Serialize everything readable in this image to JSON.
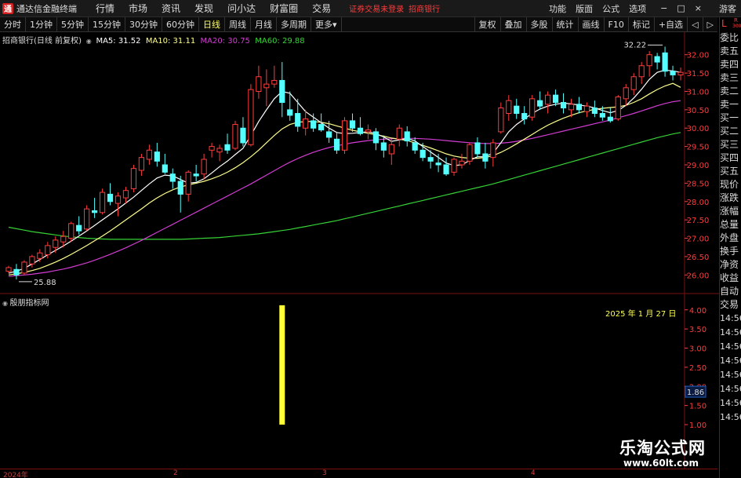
{
  "app": {
    "logo_glyph": "通",
    "title": "通达信金融终端"
  },
  "menu": [
    "行情",
    "市场",
    "资讯",
    "发现",
    "问小达",
    "财富圈",
    "交易"
  ],
  "login_warning": "证券交易未登录",
  "current_stock_tag": "招商银行",
  "right_menu": [
    "功能",
    "版面",
    "公式",
    "选项"
  ],
  "window_controls": [
    "−",
    "□",
    "×"
  ],
  "guest_label": "游客",
  "periods": [
    {
      "label": "分时",
      "active": false
    },
    {
      "label": "1分钟",
      "active": false
    },
    {
      "label": "5分钟",
      "active": false
    },
    {
      "label": "15分钟",
      "active": false
    },
    {
      "label": "30分钟",
      "active": false
    },
    {
      "label": "60分钟",
      "active": false
    },
    {
      "label": "日线",
      "active": true
    },
    {
      "label": "周线",
      "active": false
    },
    {
      "label": "月线",
      "active": false
    },
    {
      "label": "多周期",
      "active": false
    },
    {
      "label": "更多▾",
      "active": false
    }
  ],
  "toolbar_right": [
    "复权",
    "叠加",
    "多股",
    "统计",
    "画线",
    "F10",
    "标记",
    "+自选",
    "◁",
    "▷"
  ],
  "legend": {
    "stock": "招商银行(日线 前复权)",
    "ma5": "MA5: 31.52",
    "ma10": "MA10: 31.11",
    "ma20": "MA20: 30.75",
    "ma60": "MA60: 29.88"
  },
  "colors": {
    "up": "#ff3c3c",
    "down": "#54ffff",
    "ma5": "#ffffff",
    "ma10": "#ffff8c",
    "ma20": "#d23cd2",
    "ma60": "#36d236",
    "volume_bar": "#ffff33",
    "axis": "#ff3c3c"
  },
  "right_panel": {
    "lr_L": "L",
    "lr_R": "R",
    "lr_300": "300",
    "items": [
      "委比",
      "卖五",
      "卖四",
      "卖三",
      "卖二",
      "卖一",
      "买一",
      "买二",
      "买三",
      "买四",
      "买五",
      "现价",
      "涨跌",
      "涨幅",
      "总量",
      "外盘",
      "换手",
      "净资",
      "收益",
      "自动",
      "交易"
    ],
    "times": [
      "14:56",
      "14:56",
      "14:56",
      "14:56",
      "14:56",
      "14:56",
      "14:56",
      "14:56"
    ]
  },
  "indicator": {
    "title": "殷朋指标网",
    "date_label": "2025 年 1 月 27 日",
    "current_value": "1.86"
  },
  "date_axis": [
    "2024年",
    "2",
    "3",
    "4"
  ],
  "watermark": {
    "cn": "乐淘公式网",
    "url": "www.60lt.com"
  },
  "chart_data": [
    {
      "type": "candlestick",
      "title": "招商银行(日线 前复权)",
      "ylim": [
        25.6,
        32.4
      ],
      "y_ticks": [
        26.0,
        26.5,
        27.0,
        27.5,
        28.0,
        28.5,
        29.0,
        29.5,
        30.0,
        30.5,
        31.0,
        31.5,
        32.0
      ],
      "annotations": {
        "high": "32.22",
        "low": "25.88"
      },
      "candles": [
        [
          26.1,
          26.25,
          26.05,
          26.2
        ],
        [
          26.15,
          26.3,
          25.88,
          26.0
        ],
        [
          26.05,
          26.4,
          26.0,
          26.35
        ],
        [
          26.3,
          26.55,
          26.2,
          26.5
        ],
        [
          26.45,
          26.7,
          26.35,
          26.6
        ],
        [
          26.55,
          26.9,
          26.45,
          26.8
        ],
        [
          26.75,
          27.05,
          26.6,
          26.95
        ],
        [
          26.9,
          27.2,
          26.75,
          27.05
        ],
        [
          27.0,
          27.45,
          26.9,
          27.4
        ],
        [
          27.35,
          27.6,
          27.1,
          27.2
        ],
        [
          27.25,
          27.9,
          27.2,
          27.8
        ],
        [
          27.75,
          28.1,
          27.55,
          27.7
        ],
        [
          27.7,
          28.35,
          27.65,
          28.25
        ],
        [
          28.2,
          28.5,
          27.9,
          28.0
        ],
        [
          27.95,
          28.25,
          27.6,
          28.15
        ],
        [
          28.1,
          28.4,
          27.95,
          28.3
        ],
        [
          28.35,
          29.0,
          28.25,
          28.9
        ],
        [
          28.85,
          29.3,
          28.7,
          29.2
        ],
        [
          29.15,
          29.55,
          29.0,
          29.4
        ],
        [
          29.35,
          29.6,
          28.95,
          29.1
        ],
        [
          29.0,
          29.3,
          28.75,
          28.8
        ],
        [
          28.75,
          28.9,
          28.35,
          28.55
        ],
        [
          28.55,
          28.7,
          27.7,
          28.2
        ],
        [
          28.2,
          28.85,
          28.0,
          28.8
        ],
        [
          28.75,
          29.0,
          28.55,
          28.7
        ],
        [
          28.75,
          29.3,
          28.6,
          29.15
        ],
        [
          29.4,
          29.6,
          29.2,
          29.5
        ],
        [
          29.35,
          29.55,
          29.1,
          29.45
        ],
        [
          29.55,
          29.85,
          29.3,
          29.4
        ],
        [
          29.45,
          30.2,
          29.4,
          30.1
        ],
        [
          30.0,
          30.3,
          29.5,
          29.6
        ],
        [
          29.55,
          31.2,
          29.5,
          31.05
        ],
        [
          31.0,
          31.7,
          30.8,
          31.4
        ],
        [
          31.1,
          31.6,
          30.6,
          31.2
        ],
        [
          31.2,
          31.7,
          31.1,
          31.3
        ],
        [
          31.3,
          31.8,
          30.3,
          30.7
        ],
        [
          30.5,
          31.0,
          30.2,
          30.35
        ],
        [
          30.4,
          30.8,
          29.9,
          30.05
        ],
        [
          30.0,
          30.5,
          29.8,
          30.25
        ],
        [
          30.2,
          30.4,
          29.9,
          30.0
        ],
        [
          30.1,
          30.4,
          29.9,
          29.95
        ],
        [
          29.9,
          30.2,
          29.6,
          29.75
        ],
        [
          29.7,
          29.9,
          29.3,
          29.4
        ],
        [
          29.4,
          30.3,
          29.3,
          30.2
        ],
        [
          30.2,
          30.4,
          29.9,
          30.0
        ],
        [
          30.0,
          30.3,
          29.8,
          29.85
        ],
        [
          29.9,
          30.1,
          29.7,
          29.95
        ],
        [
          29.9,
          30.0,
          29.4,
          29.6
        ],
        [
          29.6,
          29.8,
          29.2,
          29.4
        ],
        [
          29.3,
          29.7,
          29.0,
          29.55
        ],
        [
          29.7,
          30.1,
          29.5,
          30.0
        ],
        [
          29.9,
          30.05,
          29.5,
          29.65
        ],
        [
          29.6,
          29.75,
          29.3,
          29.4
        ],
        [
          29.4,
          29.6,
          29.1,
          29.2
        ],
        [
          29.2,
          29.4,
          28.9,
          29.1
        ],
        [
          29.05,
          29.3,
          28.8,
          29.0
        ],
        [
          29.0,
          29.2,
          28.7,
          28.75
        ],
        [
          28.8,
          29.2,
          28.7,
          29.15
        ],
        [
          29.0,
          29.3,
          28.9,
          29.1
        ],
        [
          29.1,
          29.6,
          29.0,
          29.55
        ],
        [
          29.6,
          29.75,
          29.2,
          29.3
        ],
        [
          29.3,
          29.6,
          28.9,
          29.1
        ],
        [
          29.2,
          29.7,
          28.95,
          29.6
        ],
        [
          29.9,
          30.7,
          29.85,
          30.55
        ],
        [
          30.4,
          30.9,
          30.2,
          30.75
        ],
        [
          30.6,
          30.8,
          30.25,
          30.4
        ],
        [
          30.4,
          30.6,
          30.1,
          30.25
        ],
        [
          30.3,
          30.9,
          30.2,
          30.8
        ],
        [
          30.75,
          31.0,
          30.5,
          30.6
        ],
        [
          30.65,
          31.0,
          30.4,
          30.9
        ],
        [
          30.9,
          31.05,
          30.6,
          30.7
        ],
        [
          30.7,
          30.95,
          30.4,
          30.55
        ],
        [
          30.5,
          30.8,
          30.3,
          30.65
        ],
        [
          30.65,
          30.85,
          30.4,
          30.5
        ],
        [
          30.45,
          30.7,
          30.3,
          30.6
        ],
        [
          30.55,
          30.75,
          30.3,
          30.4
        ],
        [
          30.4,
          30.6,
          30.2,
          30.3
        ],
        [
          30.3,
          30.55,
          30.15,
          30.2
        ],
        [
          30.25,
          30.9,
          30.2,
          30.85
        ],
        [
          30.8,
          31.2,
          30.6,
          31.1
        ],
        [
          31.05,
          31.5,
          30.9,
          31.4
        ],
        [
          31.4,
          31.8,
          31.2,
          31.7
        ],
        [
          31.7,
          32.1,
          31.4,
          32.0
        ],
        [
          31.95,
          32.05,
          31.6,
          31.8
        ],
        [
          32.05,
          32.22,
          31.4,
          31.55
        ],
        [
          31.55,
          31.7,
          31.3,
          31.45
        ],
        [
          31.45,
          31.65,
          31.3,
          31.52
        ]
      ],
      "ma5": [
        26.05,
        26.1,
        26.18,
        26.3,
        26.42,
        26.55,
        26.67,
        26.79,
        26.92,
        27.06,
        27.2,
        27.35,
        27.5,
        27.65,
        27.8,
        27.96,
        28.12,
        28.3,
        28.48,
        28.64,
        28.72,
        28.7,
        28.6,
        28.5,
        28.52,
        28.62,
        28.78,
        28.95,
        29.1,
        29.28,
        29.45,
        29.8,
        30.18,
        30.5,
        30.8,
        31.0,
        30.95,
        30.7,
        30.45,
        30.3,
        30.15,
        30.0,
        29.88,
        29.85,
        29.86,
        29.88,
        29.9,
        29.85,
        29.76,
        29.64,
        29.68,
        29.72,
        29.65,
        29.5,
        29.35,
        29.2,
        29.05,
        28.98,
        29.0,
        29.12,
        29.22,
        29.22,
        29.32,
        29.6,
        29.9,
        30.1,
        30.25,
        30.4,
        30.52,
        30.6,
        30.65,
        30.68,
        30.66,
        30.63,
        30.6,
        30.55,
        30.48,
        30.42,
        30.48,
        30.62,
        30.82,
        31.06,
        31.33,
        31.52,
        31.58,
        31.56,
        31.52
      ],
      "ma10": [
        26.0,
        26.03,
        26.07,
        26.12,
        26.18,
        26.26,
        26.35,
        26.45,
        26.56,
        26.68,
        26.8,
        26.93,
        27.06,
        27.2,
        27.35,
        27.5,
        27.65,
        27.8,
        27.96,
        28.1,
        28.22,
        28.32,
        28.4,
        28.45,
        28.5,
        28.55,
        28.62,
        28.7,
        28.8,
        28.92,
        29.06,
        29.22,
        29.4,
        29.6,
        29.8,
        29.98,
        30.1,
        30.16,
        30.18,
        30.18,
        30.16,
        30.12,
        30.06,
        30.0,
        29.94,
        29.9,
        29.86,
        29.82,
        29.78,
        29.73,
        29.7,
        29.66,
        29.6,
        29.53,
        29.46,
        29.38,
        29.3,
        29.24,
        29.2,
        29.18,
        29.18,
        29.2,
        29.25,
        29.34,
        29.45,
        29.57,
        29.7,
        29.83,
        29.96,
        30.08,
        30.18,
        30.27,
        30.35,
        30.42,
        30.47,
        30.51,
        30.54,
        30.56,
        30.58,
        30.62,
        30.7,
        30.8,
        30.93,
        31.05,
        31.15,
        31.22,
        31.11
      ],
      "ma20": [
        25.96,
        25.98,
        26.0,
        26.02,
        26.05,
        26.08,
        26.12,
        26.16,
        26.21,
        26.27,
        26.33,
        26.4,
        26.48,
        26.56,
        26.65,
        26.74,
        26.84,
        26.94,
        27.05,
        27.16,
        27.27,
        27.38,
        27.49,
        27.6,
        27.71,
        27.82,
        27.93,
        28.04,
        28.15,
        28.26,
        28.37,
        28.48,
        28.6,
        28.72,
        28.84,
        28.96,
        29.07,
        29.17,
        29.26,
        29.34,
        29.41,
        29.47,
        29.52,
        29.56,
        29.6,
        29.63,
        29.66,
        29.68,
        29.7,
        29.71,
        29.72,
        29.72,
        29.72,
        29.71,
        29.7,
        29.68,
        29.66,
        29.64,
        29.62,
        29.6,
        29.59,
        29.58,
        29.58,
        29.59,
        29.61,
        29.64,
        29.68,
        29.72,
        29.77,
        29.82,
        29.87,
        29.92,
        29.97,
        30.02,
        30.07,
        30.12,
        30.17,
        30.22,
        30.28,
        30.34,
        30.4,
        30.47,
        30.54,
        30.61,
        30.67,
        30.72,
        30.75
      ],
      "ma60": [
        27.3,
        27.26,
        27.22,
        27.18,
        27.15,
        27.12,
        27.09,
        27.06,
        27.04,
        27.02,
        27.0,
        26.99,
        26.98,
        26.97,
        26.97,
        26.97,
        26.97,
        26.97,
        26.97,
        26.97,
        26.97,
        26.97,
        26.97,
        26.98,
        26.99,
        27.0,
        27.01,
        27.02,
        27.04,
        27.06,
        27.08,
        27.1,
        27.12,
        27.15,
        27.18,
        27.21,
        27.24,
        27.28,
        27.32,
        27.36,
        27.4,
        27.44,
        27.48,
        27.53,
        27.58,
        27.63,
        27.68,
        27.73,
        27.78,
        27.83,
        27.88,
        27.93,
        27.98,
        28.03,
        28.08,
        28.13,
        28.18,
        28.23,
        28.28,
        28.33,
        28.38,
        28.43,
        28.48,
        28.54,
        28.6,
        28.66,
        28.72,
        28.78,
        28.84,
        28.9,
        28.96,
        29.02,
        29.08,
        29.14,
        29.2,
        29.26,
        29.32,
        29.38,
        29.44,
        29.5,
        29.56,
        29.62,
        29.68,
        29.74,
        29.79,
        29.84,
        29.88
      ]
    },
    {
      "type": "bar",
      "title": "殷朋指标网",
      "ylim": [
        1.0,
        4.2
      ],
      "y_ticks": [
        1.0,
        1.5,
        2.0,
        2.5,
        3.0,
        3.5,
        4.0
      ],
      "bars": [
        {
          "index": 35,
          "value": 4.12
        }
      ]
    }
  ]
}
